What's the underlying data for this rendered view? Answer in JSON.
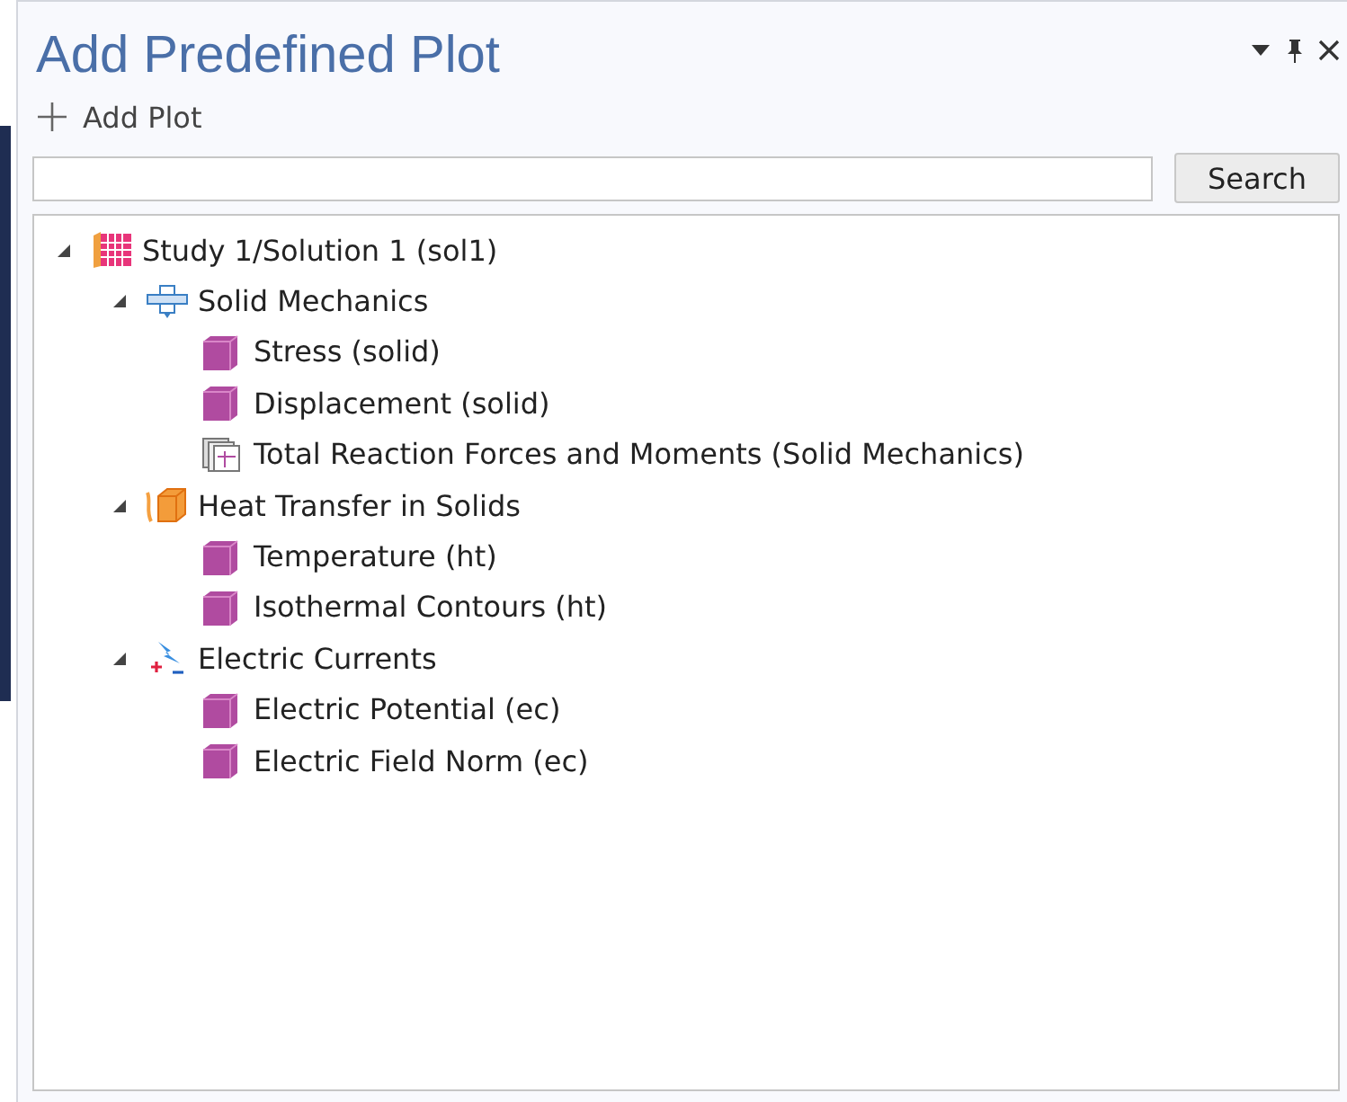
{
  "panel": {
    "title": "Add Predefined Plot"
  },
  "toolbar": {
    "add_button": "Add Plot"
  },
  "search": {
    "button": "Search"
  },
  "tree": [
    {
      "label": "Study 1/Solution 1 (sol1)",
      "kind": "study",
      "expanded": true,
      "children": [
        {
          "label": "Solid Mechanics",
          "kind": "solid",
          "expanded": true,
          "children": [
            {
              "label": "Stress (solid)",
              "kind": "plot"
            },
            {
              "label": "Displacement (solid)",
              "kind": "plot"
            },
            {
              "label": "Total Reaction Forces and Moments (Solid Mechanics)",
              "kind": "table"
            }
          ]
        },
        {
          "label": "Heat Transfer in Solids",
          "kind": "heat",
          "expanded": true,
          "children": [
            {
              "label": "Temperature (ht)",
              "kind": "plot"
            },
            {
              "label": "Isothermal Contours (ht)",
              "kind": "plot"
            }
          ]
        },
        {
          "label": "Electric Currents",
          "kind": "electric",
          "expanded": true,
          "children": [
            {
              "label": "Electric Potential (ec)",
              "kind": "plot"
            },
            {
              "label": "Electric Field Norm (ec)",
              "kind": "plot"
            }
          ]
        }
      ]
    }
  ]
}
